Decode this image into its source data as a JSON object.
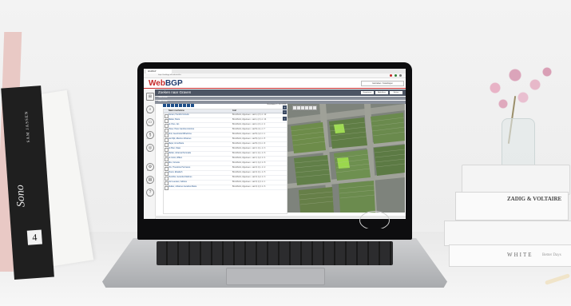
{
  "browser": {
    "tab_title": "WebBGP",
    "url": "https://webbgp.nl/cadastre/list"
  },
  "app": {
    "logo_a": "Web",
    "logo_b": "BGP",
    "logo_sub": "5.0",
    "header_button": "Gebruiker / Instellingen"
  },
  "page": {
    "title": "Zoeken naar Graven",
    "buttons": [
      "Exporteren",
      "Afdrukken",
      "Sluiten"
    ],
    "sub1": "Tabel tonen",
    "sub2": "Kaart tonen"
  },
  "list": {
    "count": "Resultaten 1 - 20 / 2313",
    "headers": [
      "Naam overledene",
      "Graf"
    ],
    "rows": [
      {
        "name": "Jansen, Hendrik Cornelis",
        "grave": "Bronkhorst, Algemeen - vak A, rij 3, nr. 12"
      },
      {
        "name": "Bakker, Maria",
        "grave": "Bronkhorst, Algemeen - vak A, rij 3, nr. 14"
      },
      {
        "name": "de Vries, Jan",
        "grave": "Bronkhorst, Algemeen - vak A, rij 4, nr. 2"
      },
      {
        "name": "Visser, Pieter Jacobus Antonius",
        "grave": "Bronkhorst, Algemeen - vak B, rij 1, nr. 7"
      },
      {
        "name": "Smit, Geertruida Wilhelmina",
        "grave": "Bronkhorst, Algemeen - vak B, rij 2, nr. 1"
      },
      {
        "name": "van Dijk, Albertus Johannes",
        "grave": "Bronkhorst, Algemeen - vak B, rij 2, nr. 5"
      },
      {
        "name": "Meijer, Anna Maria",
        "grave": "Bronkhorst, Algemeen - vak B, rij 3, nr. 9"
      },
      {
        "name": "de Boer, Klaas",
        "grave": "Bronkhorst, Algemeen - vak C, rij 1, nr. 3"
      },
      {
        "name": "Mulder, Johanna Petronella",
        "grave": "Bronkhorst, Algemeen - vak C, rij 1, nr. 6"
      },
      {
        "name": "de Groot, Willem",
        "grave": "Bronkhorst, Algemeen - vak C, rij 2, nr. 4"
      },
      {
        "name": "Bos, Cornelia",
        "grave": "Bronkhorst, Algemeen - vak C, rij 2, nr. 8"
      },
      {
        "name": "Vos, Theodorus Hermanus",
        "grave": "Bronkhorst, Algemeen - vak D, rij 1, nr. 2"
      },
      {
        "name": "Peters, Elisabeth",
        "grave": "Bronkhorst, Algemeen - vak D, rij 1, nr. 5"
      },
      {
        "name": "Hendriks, Gerardus Martinus",
        "grave": "Bronkhorst, Algemeen - vak D, rij 2, nr. 3"
      },
      {
        "name": "van Leeuwen, Adriana",
        "grave": "Bronkhorst, Algemeen - vak D, rij 3, nr. 1"
      },
      {
        "name": "Dekker, Johannes Gerardus Maria",
        "grave": "Bronkhorst, Algemeen - vak D, rij 3, nr. 6"
      }
    ]
  },
  "rail": [
    "Home",
    "Zoeken",
    "Graven",
    "Rechten",
    "Kaart",
    "Beheer",
    "Rapport",
    "Help"
  ],
  "scene": {
    "book_black_title": "Sono",
    "book_black_author": "SAM JASSEN",
    "book_black_number": "4",
    "book_right_spine": "ZADIG & VOLTAIRE",
    "book_bottom": "WHITE",
    "book_bottom_sub": "Better Days"
  }
}
